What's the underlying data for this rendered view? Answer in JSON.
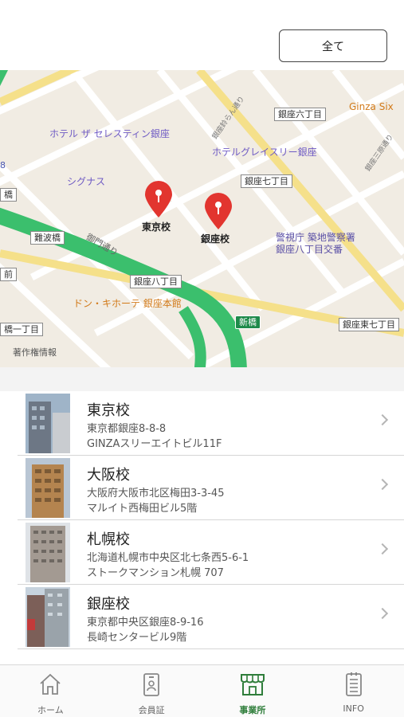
{
  "header": {
    "filter_label": "全て"
  },
  "map": {
    "labels": {
      "hotel_celestine": "ホテル ザ セレスティン銀座",
      "hotel_gracery": "ホテルグレイスリー銀座",
      "ginza_six": "Ginza Six",
      "cygnus": "シグナス",
      "ginza6": "銀座六丁目",
      "ginza7": "銀座七丁目",
      "ginza8": "銀座八丁目",
      "ginza_east7": "銀座東七丁目",
      "naniwabashi": "難波橋",
      "miyuki_dori": "御門通り",
      "police": "警視庁 築地警察署",
      "police2": "銀座八丁目交番",
      "donki": "ドン・キホーテ 銀座本館",
      "shinbashi": "新橋",
      "ichome": "橋一丁目",
      "chosaku": "著作権情報",
      "mae": "前",
      "bashi": "橋",
      "num8": "8",
      "road1": "銀座鈴らん通り",
      "road2": "銀座三原通り"
    },
    "pins": [
      {
        "label": "東京校"
      },
      {
        "label": "銀座校"
      }
    ]
  },
  "schools": [
    {
      "name": "東京校",
      "address": "東京都銀座8-8-8",
      "building": "GINZAスリーエイトビル11F"
    },
    {
      "name": "大阪校",
      "address": "大阪府大阪市北区梅田3-3-45",
      "building": "マルイト西梅田ビル5階"
    },
    {
      "name": "札幌校",
      "address": "北海道札幌市中央区北七条西5-6-1",
      "building": "ストークマンション札幌 707"
    },
    {
      "name": "銀座校",
      "address": "東京都中央区銀座8-9-16",
      "building": "長崎センタービル9階"
    }
  ],
  "tabs": [
    {
      "label": "ホーム",
      "icon": "home-icon"
    },
    {
      "label": "会員証",
      "icon": "member-card-icon"
    },
    {
      "label": "事業所",
      "icon": "store-icon",
      "active": true
    },
    {
      "label": "INFO",
      "icon": "info-document-icon"
    }
  ],
  "colors": {
    "accent": "#2e7d3a",
    "pin": "#e2352f",
    "road_green": "#3bbf6d"
  }
}
